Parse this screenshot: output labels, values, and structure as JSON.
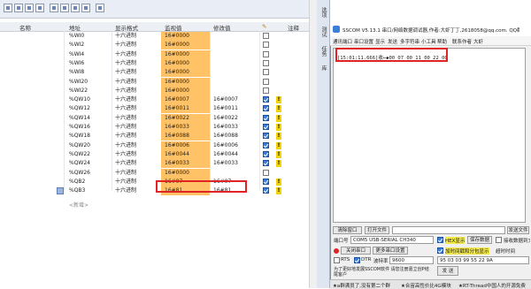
{
  "watch_table": {
    "headers": {
      "name": "名称",
      "address": "地址",
      "display_format": "显示格式",
      "monitor_value": "监视值",
      "modify_value": "修改值",
      "comment": "注释"
    },
    "rows": [
      {
        "address": "%WI0",
        "format": "十六进制",
        "monitor": "16#0000",
        "modify": "",
        "checked": false,
        "warn": false
      },
      {
        "address": "%WI2",
        "format": "十六进制",
        "monitor": "16#0000",
        "modify": "",
        "checked": false,
        "warn": false
      },
      {
        "address": "%WI4",
        "format": "十六进制",
        "monitor": "16#0000",
        "modify": "",
        "checked": false,
        "warn": false
      },
      {
        "address": "%WI6",
        "format": "十六进制",
        "monitor": "16#0000",
        "modify": "",
        "checked": false,
        "warn": false
      },
      {
        "address": "%WI8",
        "format": "十六进制",
        "monitor": "16#0000",
        "modify": "",
        "checked": false,
        "warn": false
      },
      {
        "address": "%WI20",
        "format": "十六进制",
        "monitor": "16#0000",
        "modify": "",
        "checked": false,
        "warn": false
      },
      {
        "address": "%WI22",
        "format": "十六进制",
        "monitor": "16#0000",
        "modify": "",
        "checked": false,
        "warn": false
      },
      {
        "address": "%QW10",
        "format": "十六进制",
        "monitor": "16#0007",
        "modify": "16#0007",
        "checked": true,
        "warn": true
      },
      {
        "address": "%QW12",
        "format": "十六进制",
        "monitor": "16#0011",
        "modify": "16#0011",
        "checked": true,
        "warn": true
      },
      {
        "address": "%QW14",
        "format": "十六进制",
        "monitor": "16#0022",
        "modify": "16#0022",
        "checked": true,
        "warn": true
      },
      {
        "address": "%QW16",
        "format": "十六进制",
        "monitor": "16#0033",
        "modify": "16#0033",
        "checked": true,
        "warn": true
      },
      {
        "address": "%QW18",
        "format": "十六进制",
        "monitor": "16#0088",
        "modify": "16#0088",
        "checked": true,
        "warn": true
      },
      {
        "address": "%QW20",
        "format": "十六进制",
        "monitor": "16#0006",
        "modify": "16#0006",
        "checked": true,
        "warn": true
      },
      {
        "address": "%QW22",
        "format": "十六进制",
        "monitor": "16#0044",
        "modify": "16#0044",
        "checked": true,
        "warn": true
      },
      {
        "address": "%QW24",
        "format": "十六进制",
        "monitor": "16#0033",
        "modify": "16#0033",
        "checked": true,
        "warn": true
      },
      {
        "address": "%QW26",
        "format": "十六进制",
        "monitor": "16#0000",
        "modify": "",
        "checked": false,
        "warn": false
      },
      {
        "address": "%QB2",
        "format": "十六进制",
        "monitor": "16#07",
        "modify": "16#07",
        "checked": true,
        "warn": true
      },
      {
        "address": "%QB3",
        "format": "十六进制",
        "monitor": "16#81",
        "modify": "16#81",
        "checked": true,
        "warn": true
      }
    ],
    "add_new_label": "<新增>"
  },
  "side_tabs": [
    "选项",
    "测试",
    "任务",
    "库"
  ],
  "sscom": {
    "title": "SSCOM V5.13.1 串口/网络数据调试器,作者:大虾丁丁,2618058@qq.com. QQ群",
    "menu": [
      "通讯端口",
      "串口设置",
      "显示",
      "发送",
      "多字符串",
      "小工具",
      "帮助",
      "联系作者",
      "大虾"
    ],
    "received_line": "[15:01:11.666]收←◆00 07 00 11 00 22 00",
    "clear_window": "清除窗口",
    "open_file": "打开文件",
    "send_file": "发送文件",
    "port_label": "端口号",
    "port_value": "COM5 USB-SERIAL CH340",
    "hex_display": "HEX显示",
    "save_data": "保存数据",
    "recv_to_file": "接收数据到文件",
    "close_port": "关闭串口",
    "more_settings": "更多串口设置",
    "add_timestamp": "加时间戳和分包显示",
    "timeout_label": "超时时间",
    "rts": "RTS",
    "dtr": "DTR",
    "baud_label": "波特率",
    "baud_value": "9600",
    "send_input": "95 03 03 99 55 22 9A",
    "send_button": "发 送",
    "promo": "为了更好地发展SSCOM软件 请您注册嘉立创P结尾客户",
    "status_left": "★a群满员了,没有第二个群",
    "status_mid": "★合宙高性价比4G模块",
    "status_right": "★RT-Thread中国人的开源免费"
  },
  "colors": {
    "monitor_bg": "#ffc266",
    "highlight_red": "#e02424",
    "checkbox_blue": "#3b7fd9",
    "warning_yellow": "#f4d20b"
  }
}
